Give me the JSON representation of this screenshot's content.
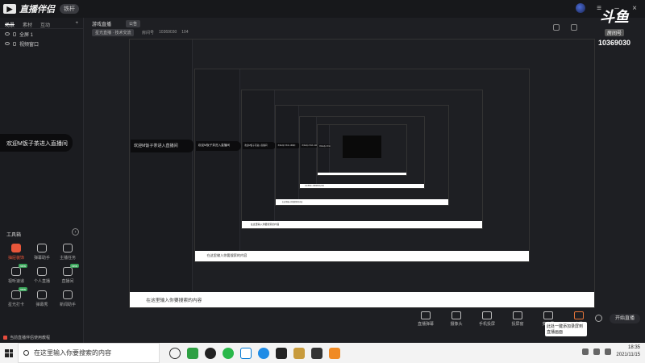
{
  "app": {
    "name": "直播伴侣",
    "badge": "铁杆"
  },
  "left_tabs": [
    "场景",
    "素材",
    "互动"
  ],
  "scenes": [
    "全屏 1",
    "视频窗口"
  ],
  "welcome_text": "欢迎M饭子茶进入直播间",
  "tools": {
    "heading": "工具箱",
    "items": [
      {
        "label": "抽屉装饰",
        "highlight": true,
        "new": false
      },
      {
        "label": "弹幕助手",
        "highlight": false,
        "new": false
      },
      {
        "label": "主播任务",
        "highlight": false,
        "new": false
      },
      {
        "label": "视听速递",
        "highlight": false,
        "new": true
      },
      {
        "label": "个人直播",
        "highlight": false,
        "new": false
      },
      {
        "label": "直播间",
        "highlight": false,
        "new": true
      },
      {
        "label": "星光打卡",
        "highlight": false,
        "new": true
      },
      {
        "label": "弹幕秀",
        "highlight": false,
        "new": false
      },
      {
        "label": "新闻助手",
        "highlight": false,
        "new": false
      }
    ]
  },
  "notice": "当前直播伴侣使用教程",
  "header": {
    "title": "游戏直播",
    "tag": "公告",
    "category": "星光直播 · 技术交流",
    "room_label": "房间号",
    "room_number": "10369030",
    "fans": "104"
  },
  "watermark": {
    "logo": "斗鱼",
    "sub": "房间号",
    "number": "10369030"
  },
  "bottom_tools": [
    {
      "label": "直播弹幕"
    },
    {
      "label": "摄像头"
    },
    {
      "label": "手机投屏"
    },
    {
      "label": "投屏窗"
    },
    {
      "label": "麦克风"
    },
    {
      "label": "音量"
    },
    {
      "label": "截图"
    },
    {
      "label": "设置"
    }
  ],
  "popup_text": "此处一键添加录屏到直播画面",
  "start_live": "开始直播",
  "taskbar": {
    "search_placeholder": "在这里输入你要搜索的内容",
    "time": "18:35",
    "date": "2021/11/15"
  },
  "colors": {
    "accent": "#e8563a",
    "bg": "#1e1f23",
    "new_tag": "#3aa55a"
  }
}
